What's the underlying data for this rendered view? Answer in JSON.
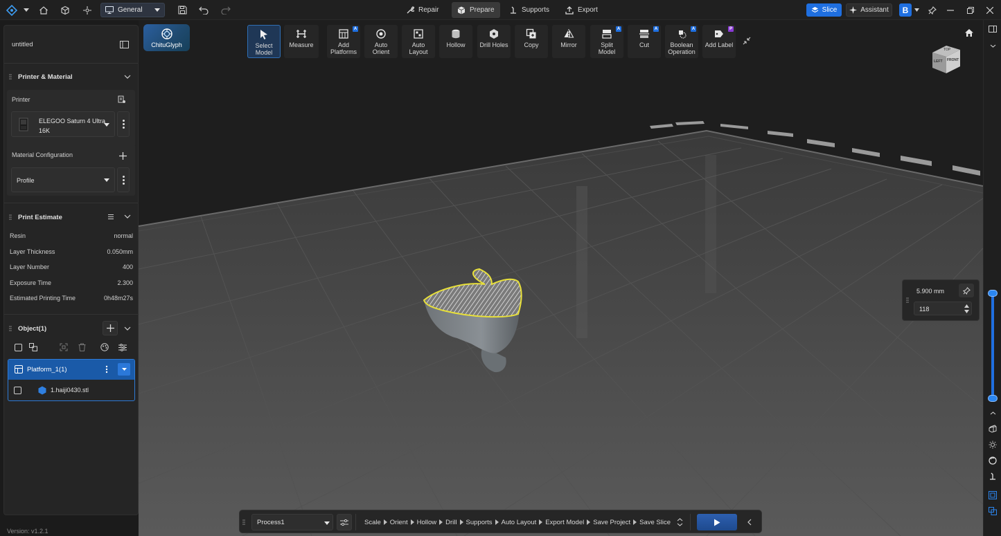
{
  "topbar": {
    "workspace": "General",
    "modes": [
      {
        "label": "Repair",
        "icon": "wrench-icon"
      },
      {
        "label": "Prepare",
        "icon": "cube-icon",
        "active": true
      },
      {
        "label": "Supports",
        "icon": "support-icon"
      },
      {
        "label": "Export",
        "icon": "export-icon"
      }
    ],
    "slice_label": "Slice",
    "assistant_label": "Assistant",
    "account_letter": "B"
  },
  "brand": {
    "name": "ChituGlyph"
  },
  "project": {
    "name": "untitled"
  },
  "printer_material": {
    "title": "Printer & Material",
    "printer_label": "Printer",
    "printer_name_line1": "ELEGOO Saturn 4 Ultra",
    "printer_name_line2": "16K",
    "material_label": "Material Configuration",
    "profile_value": "Profile"
  },
  "print_estimate": {
    "title": "Print Estimate",
    "rows": [
      {
        "label": "Resin",
        "value": "normal"
      },
      {
        "label": "Layer Thickness",
        "value": "0.050mm"
      },
      {
        "label": "Layer Number",
        "value": "400"
      },
      {
        "label": "Exposure Time",
        "value": "2.300"
      },
      {
        "label": "Estimated Printing Time",
        "value": "0h48m27s"
      }
    ]
  },
  "objects": {
    "title": "Object(1)",
    "platform": "Platform_1(1)",
    "file": "1.haiji0430.stl"
  },
  "tools": [
    {
      "label1": "Select",
      "label2": "Model",
      "icon": "cursor-icon"
    },
    {
      "label1": "Measure",
      "label2": "",
      "icon": "measure-icon"
    },
    {
      "label1": "Add",
      "label2": "Platforms",
      "icon": "add-platform-icon"
    },
    {
      "label1": "Auto",
      "label2": "Orient",
      "icon": "orient-icon"
    },
    {
      "label1": "Auto",
      "label2": "Layout",
      "icon": "layout-icon"
    },
    {
      "label1": "Hollow",
      "label2": "",
      "icon": "hollow-icon"
    },
    {
      "label1": "Drill Holes",
      "label2": "",
      "icon": "drill-icon"
    },
    {
      "label1": "Copy",
      "label2": "",
      "icon": "copy-icon"
    },
    {
      "label1": "Mirror",
      "label2": "",
      "icon": "mirror-icon"
    },
    {
      "label1": "Split",
      "label2": "Model",
      "icon": "split-icon"
    },
    {
      "label1": "Cut",
      "label2": "",
      "icon": "cut-icon"
    },
    {
      "label1": "Boolean",
      "label2": "Operation",
      "icon": "boolean-icon"
    },
    {
      "label1": "Add Label",
      "label2": "",
      "icon": "label-icon"
    }
  ],
  "viewcube": {
    "front": "FRONT",
    "left": "LEFT",
    "top": "TOP"
  },
  "layer_panel": {
    "height_value": "5.900 mm",
    "layer_value": "118"
  },
  "layer_slider": {
    "upper_fraction": 0.0,
    "lower_fraction": 1.0
  },
  "bottombar": {
    "process": "Process1",
    "steps": [
      "Scale",
      "Orient",
      "Hollow",
      "Drill",
      "Supports",
      "Auto Layout",
      "Export Model",
      "Save Project",
      "Save Slice"
    ]
  },
  "version": "Version: v1.2.1",
  "colors": {
    "accent": "#1f6fe0",
    "selection": "#1a5aa8",
    "outline": "#e8e03a"
  }
}
